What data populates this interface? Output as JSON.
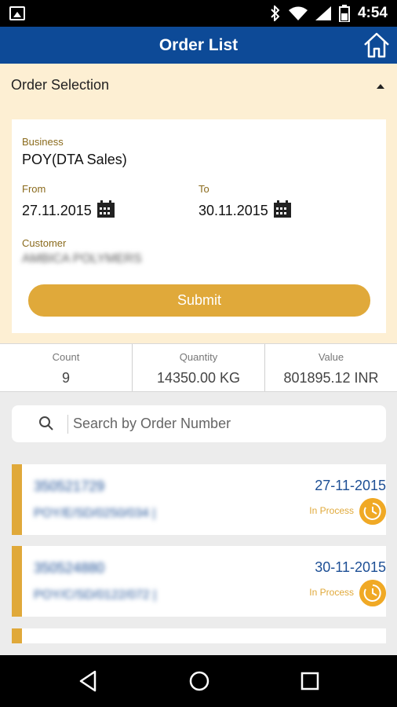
{
  "status_bar": {
    "time": "4:54"
  },
  "header": {
    "title": "Order List"
  },
  "selection": {
    "title": "Order Selection",
    "business_label": "Business",
    "business_value": "POY(DTA Sales)",
    "from_label": "From",
    "from_value": "27.11.2015",
    "to_label": "To",
    "to_value": "30.11.2015",
    "customer_label": "Customer",
    "customer_value": "AMBICA POLYMERS",
    "submit_label": "Submit"
  },
  "stats": [
    {
      "label": "Count",
      "value": "9"
    },
    {
      "label": "Quantity",
      "value": "14350.00 KG"
    },
    {
      "label": "Value",
      "value": "801895.12 INR"
    }
  ],
  "search": {
    "placeholder": "Search by Order Number"
  },
  "orders": [
    {
      "number": "350521729",
      "code": "POY/E/SD/0250/034 |",
      "date": "27-11-2015",
      "status": "In Process"
    },
    {
      "number": "350524880",
      "code": "POY/C/SD/0122/072 |",
      "date": "30-11-2015",
      "status": "In Process"
    }
  ],
  "colors": {
    "appbar": "#0d4a97",
    "accent": "#e0a93a",
    "panel": "#fdefd3"
  },
  "icons": [
    "image-icon",
    "bluetooth-icon",
    "wifi-icon",
    "signal-icon",
    "battery-icon",
    "home-icon",
    "calendar-icon",
    "search-icon",
    "clock-icon",
    "back-icon",
    "home-circle-icon",
    "recents-icon"
  ]
}
